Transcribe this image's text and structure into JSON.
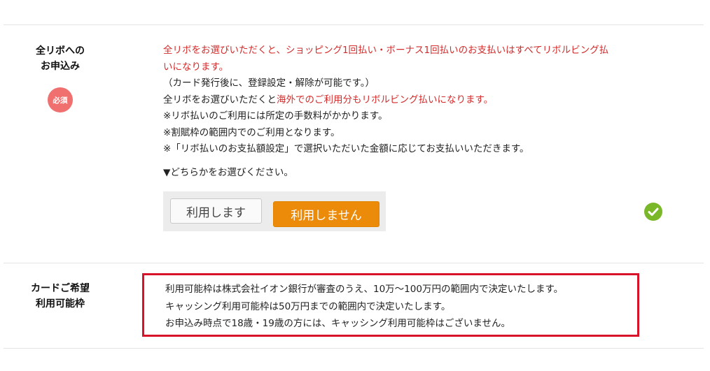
{
  "section1": {
    "label_line1": "全リボへの",
    "label_line2": "お申込み",
    "required_badge": "必須",
    "line1_red": "全リボをお選びいただくと、ショッピング1回払い・ボーナス1回払いのお支払いはすべてリボルビング払",
    "line2_red": "いになります。",
    "line3": "（カード発行後に、登録設定・解除が可能です。）",
    "line4_prefix": "全リボをお選びいただくと",
    "line4_red": "海外でのご利用分もリボルビング払いになります。",
    "line5": "※リボ払いのご利用には所定の手数料がかかります。",
    "line6": "※割賦枠の範囲内でのご利用となります。",
    "line7": "※「リボ払いのお支払額設定」で選択いただいた金額に応じてお支払いいただきます。",
    "prompt": "▼どちらかをお選びください。",
    "button_yes": "利用します",
    "button_no": "利用しません",
    "status_icon": "check-circle-icon"
  },
  "section2": {
    "label_line1": "カードご希望",
    "label_line2": "利用可能枠",
    "line1": "利用可能枠は株式会社イオン銀行が審査のうえ、10万～100万円の範囲内で決定いたします。",
    "line2": "キャッシング利用可能枠は50万円までの範囲内で決定いたします。",
    "line3": "お申込み時点で18歳・19歳の方には、キャッシング利用可能枠はございません。"
  },
  "colors": {
    "accent_red": "#d42b2b",
    "highlight_box": "#d7132a",
    "selected_button": "#ec8b0a",
    "check_green": "#7ab829",
    "badge_pink": "#f07070"
  }
}
